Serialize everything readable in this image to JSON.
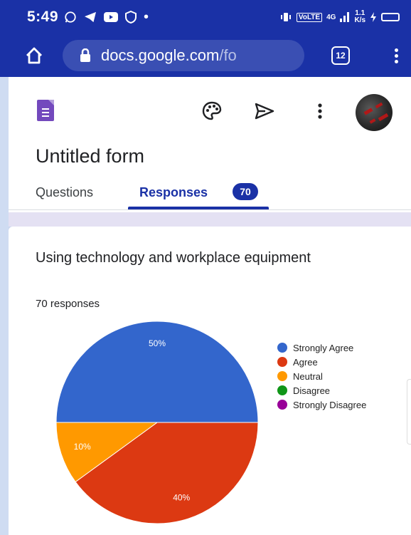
{
  "status_bar": {
    "time": "5:49",
    "volte": "VoLTE",
    "network": "4G",
    "speed": "1.1",
    "speed_unit": "K/s"
  },
  "browser": {
    "url_host": "docs.google.com",
    "url_path": "/fo",
    "tab_count": "12"
  },
  "form": {
    "title": "Untitled form",
    "tabs": [
      {
        "label": "Questions"
      },
      {
        "label": "Responses",
        "badge": "70"
      }
    ]
  },
  "question": {
    "title": "Using technology and workplace equipment",
    "response_count": "70 responses"
  },
  "chart_data": {
    "type": "pie",
    "categories": [
      "Strongly Agree",
      "Agree",
      "Neutral",
      "Disagree",
      "Strongly Disagree"
    ],
    "values": [
      50,
      40,
      10,
      0,
      0
    ],
    "labels": [
      "50%",
      "40%",
      "10%",
      "",
      ""
    ],
    "colors": [
      "#3366cc",
      "#dc3912",
      "#ff9900",
      "#109618",
      "#990099"
    ],
    "legend_position": "right"
  }
}
